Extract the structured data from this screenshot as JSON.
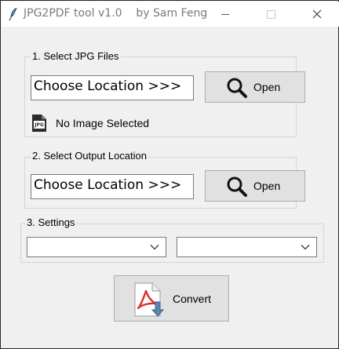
{
  "window": {
    "title": "JPG2PDF tool v1.0    by Sam Feng"
  },
  "section1": {
    "heading": "1. Select JPG Files",
    "location_value": "Choose Location >>>",
    "open_label": "Open",
    "file_icon_label": "JPG",
    "status": "No Image Selected"
  },
  "section2": {
    "heading": "2. Select Output Location",
    "location_value": "Choose Location >>>",
    "open_label": "Open"
  },
  "section3": {
    "heading": "3. Settings",
    "combo1_value": "",
    "combo2_value": ""
  },
  "convert": {
    "label": "Convert"
  },
  "colors": {
    "pdf_red": "#d9302b",
    "arrow_blue": "#5b84b1"
  },
  "icons": [
    "feather-icon",
    "minimize-icon",
    "maximize-icon",
    "close-icon",
    "magnifier-icon",
    "jpg-file-icon",
    "chevron-down-icon",
    "pdf-convert-icon"
  ]
}
